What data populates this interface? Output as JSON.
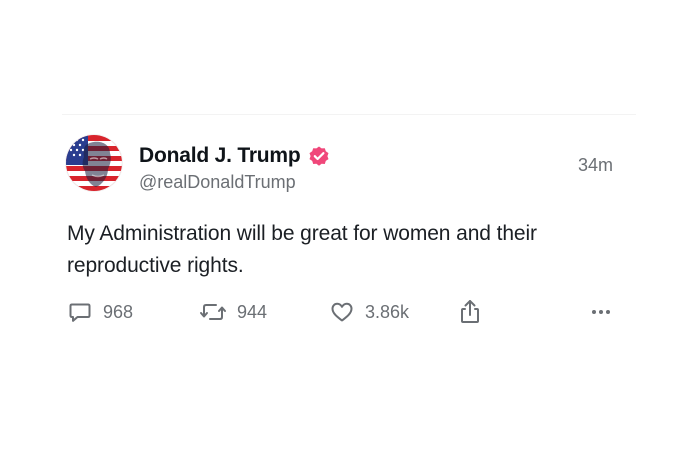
{
  "post": {
    "author": {
      "display_name": "Donald J. Trump",
      "handle": "@realDonaldTrump",
      "verified": true,
      "verified_badge_color": "#f0477a"
    },
    "timestamp": "34m",
    "text": "My Administration will be great for women and their reproductive rights.",
    "actions": {
      "reply": {
        "icon": "comment-icon",
        "count": "968"
      },
      "repost": {
        "icon": "repost-icon",
        "count": "944"
      },
      "like": {
        "icon": "heart-icon",
        "count": "3.86k"
      },
      "share": {
        "icon": "share-icon"
      },
      "more": {
        "icon": "more-options-icon"
      }
    }
  },
  "colors": {
    "text_primary": "#0f1419",
    "text_secondary": "#6b6f74",
    "background": "#ffffff",
    "divider": "#f3f3f3"
  }
}
